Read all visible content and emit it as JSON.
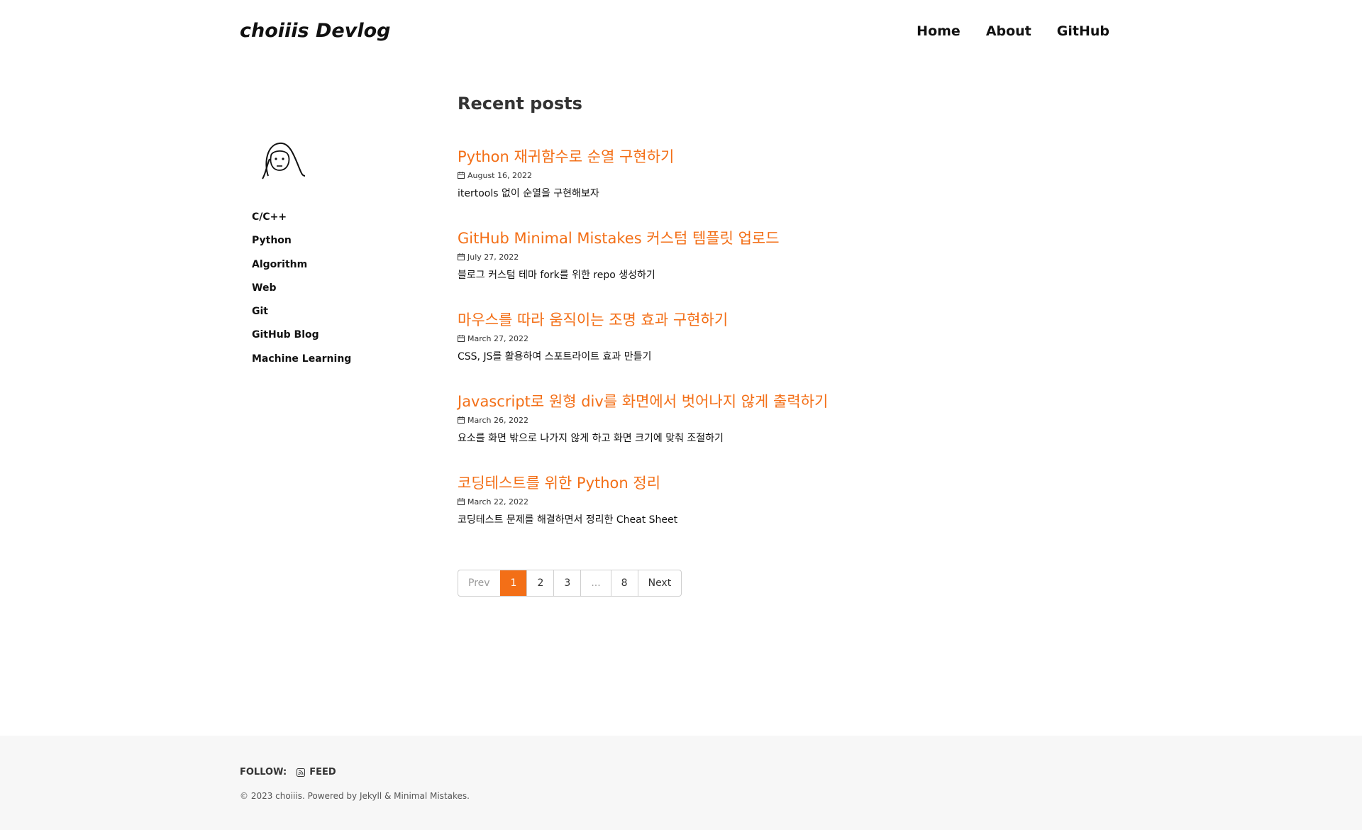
{
  "site": {
    "title": "choiiis Devlog"
  },
  "nav": {
    "items": [
      "Home",
      "About",
      "GitHub"
    ]
  },
  "sidebar": {
    "categories": [
      "C/C++",
      "Python",
      "Algorithm",
      "Web",
      "Git",
      "GitHub Blog",
      "Machine Learning"
    ]
  },
  "main": {
    "title": "Recent posts",
    "posts": [
      {
        "title": "Python 재귀함수로 순열 구현하기",
        "date": "August 16, 2022",
        "excerpt": "itertools 없이 순열을 구현해보자"
      },
      {
        "title": "GitHub Minimal Mistakes 커스텀 템플릿 업로드",
        "date": "July 27, 2022",
        "excerpt": "블로그 커스텀 테마 fork를 위한 repo 생성하기"
      },
      {
        "title": "마우스를 따라 움직이는 조명 효과 구현하기",
        "date": "March 27, 2022",
        "excerpt": "CSS, JS를 활용하여 스포트라이트 효과 만들기"
      },
      {
        "title": "Javascript로 원형 div를 화면에서 벗어나지 않게 출력하기",
        "date": "March 26, 2022",
        "excerpt": "요소를 화면 밖으로 나가지 않게 하고 화면 크기에 맞춰 조절하기"
      },
      {
        "title": "코딩테스트를 위한 Python 정리",
        "date": "March 22, 2022",
        "excerpt": "코딩테스트 문제를 해결하면서 정리한 Cheat Sheet"
      }
    ]
  },
  "pagination": {
    "prev": "Prev",
    "pages": [
      "1",
      "2",
      "3",
      "...",
      "8"
    ],
    "next": "Next",
    "current": "1"
  },
  "footer": {
    "follow_label": "FOLLOW:",
    "feed_label": "FEED",
    "copyright": "© 2023 choiiis. Powered by Jekyll & Minimal Mistakes."
  },
  "icons": {
    "calendar": "calendar-icon",
    "feed": "rss-icon",
    "avatar": "face-doodle-icon"
  },
  "colors": {
    "accent": "#f36f17",
    "footer_bg": "#f7f7f7"
  }
}
